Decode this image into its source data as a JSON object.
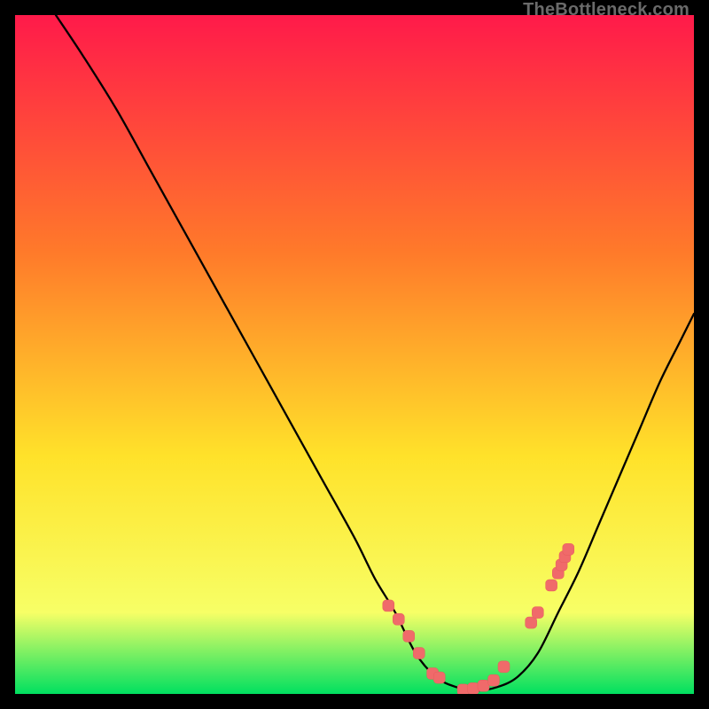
{
  "watermark": "TheBottleneck.com",
  "chart_data": {
    "type": "line",
    "title": "",
    "xlabel": "",
    "ylabel": "",
    "xlim": [
      0,
      100
    ],
    "ylim": [
      0,
      100
    ],
    "series": [
      {
        "name": "bottleneck-curve",
        "x": [
          6,
          10,
          15,
          20,
          25,
          30,
          35,
          40,
          45,
          50,
          53,
          56,
          59,
          62,
          65,
          68,
          71,
          74,
          77,
          80,
          83,
          86,
          89,
          92,
          95,
          98,
          100
        ],
        "y": [
          100,
          94,
          86,
          77,
          68,
          59,
          50,
          41,
          32,
          23,
          17,
          12,
          6,
          2.5,
          1,
          0.5,
          1,
          2.5,
          6,
          12,
          18,
          25,
          32,
          39,
          46,
          52,
          56
        ]
      }
    ],
    "markers": {
      "name": "highlight-points",
      "x": [
        55,
        56.5,
        58,
        59.5,
        61.5,
        62.5,
        66,
        67.5,
        69,
        70.5,
        72,
        76,
        77,
        79,
        80,
        80.5,
        81,
        81.5
      ],
      "y": [
        13,
        11,
        8.5,
        6,
        3,
        2.4,
        0.6,
        0.8,
        1.2,
        2,
        4,
        10.5,
        12,
        16,
        17.8,
        19,
        20.2,
        21.3
      ]
    },
    "colors": {
      "gradient_top": "#ff1a4a",
      "gradient_mid1": "#ff7a2a",
      "gradient_mid2": "#ffe22a",
      "gradient_mid3": "#f7ff66",
      "gradient_bottom": "#00e060",
      "curve": "#000000",
      "marker_fill": "#f06a6a",
      "marker_stroke": "#e65c5c"
    }
  }
}
